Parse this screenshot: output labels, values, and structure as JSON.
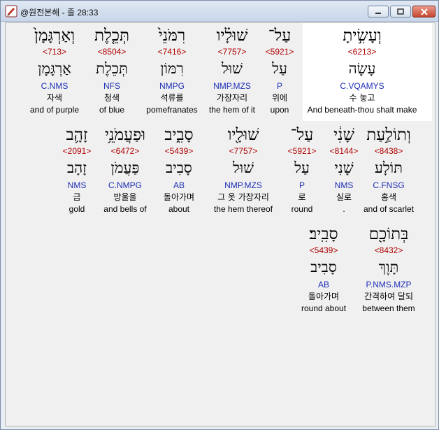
{
  "window": {
    "title": "@원전본해 - 줄 28:33"
  },
  "colors": {
    "strong": "#b00000",
    "morph": "#1f2fb5",
    "highlight": "#ffffff"
  },
  "rows": [
    {
      "words": [
        {
          "heb": "וְעָשִׂ֣יתָ",
          "strong": "<6213>",
          "root": "עָשָׂה",
          "morph": "C.VQAMYS",
          "kor": "수 놓고",
          "eng": "And beneath-thou shalt make"
        },
        {
          "heb": "עַל־",
          "strong": "<5921>",
          "root": "עַל",
          "morph": "P",
          "kor": "위에",
          "eng": "upon"
        },
        {
          "heb": "שׁוּלָ֗יו",
          "strong": "<7757>",
          "root": "שׁוּל",
          "morph": "NMP.MZS",
          "kor": "가장자리",
          "eng": "the hem of it"
        },
        {
          "heb": "רִמֹּנֵי֙",
          "strong": "<7416>",
          "root": "רִמּוֹן",
          "morph": "NMPG",
          "kor": "석류를",
          "eng": "pomefranates"
        },
        {
          "heb": "תְּכֵ֤לֶת",
          "strong": "<8504>",
          "root": "תְּכֵלֶת",
          "morph": "NFS",
          "kor": "청색",
          "eng": "of blue"
        },
        {
          "heb": "וְאַרְגָּמָן֙",
          "strong": "<713>",
          "root": "אַרְגָּמָן",
          "morph": "C.NMS",
          "kor": "자색",
          "eng": "and of purple"
        }
      ]
    },
    {
      "words": [
        {
          "heb": "וְתוֹלַ֣עַת",
          "strong": "<8438>",
          "root": "תּוֹלָע",
          "morph": "C.FNSG",
          "kor": "홍색",
          "eng": "and of scarlet"
        },
        {
          "heb": "שָׁנִ֔י",
          "strong": "<8144>",
          "root": "שָׁנִי",
          "morph": "NMS",
          "kor": "실로",
          "eng": "."
        },
        {
          "heb": "עַל־",
          "strong": "<5921>",
          "root": "עַל",
          "morph": "P",
          "kor": "로",
          "eng": "round"
        },
        {
          "heb": "שׁוּלָ֖יו",
          "strong": "<7757>",
          "root": "שׁוּל",
          "morph": "NMP.MZS",
          "kor": "그 옷 가장자리",
          "eng": "the hem thereof"
        },
        {
          "heb": "סָבִ֑יב",
          "strong": "<5439>",
          "root": "סָבִיב",
          "morph": "AB",
          "kor": "돌아가며",
          "eng": "about"
        },
        {
          "heb": "וּפַעֲמֹנֵ֥י",
          "strong": "<6472>",
          "root": "פַּעֲמֹן",
          "morph": "C.NMPG",
          "kor": "방울을",
          "eng": "and bells of"
        },
        {
          "heb": "זָהָ֛ב",
          "strong": "<2091>",
          "root": "זָהָב",
          "morph": "NMS",
          "kor": "금",
          "eng": "gold"
        }
      ]
    },
    {
      "words": [
        {
          "heb": "בְּתוֹכָ֖ם",
          "strong": "<8432>",
          "root": "תָּוֶךְ",
          "morph": "P.NMS.MZP",
          "kor": "간격하여 달되",
          "eng": "between them"
        },
        {
          "heb": "סָבִֽיב׃",
          "strong": "<5439>",
          "root": "סָבִיב",
          "morph": "AB",
          "kor": "돌아가며",
          "eng": "round about"
        }
      ]
    }
  ]
}
